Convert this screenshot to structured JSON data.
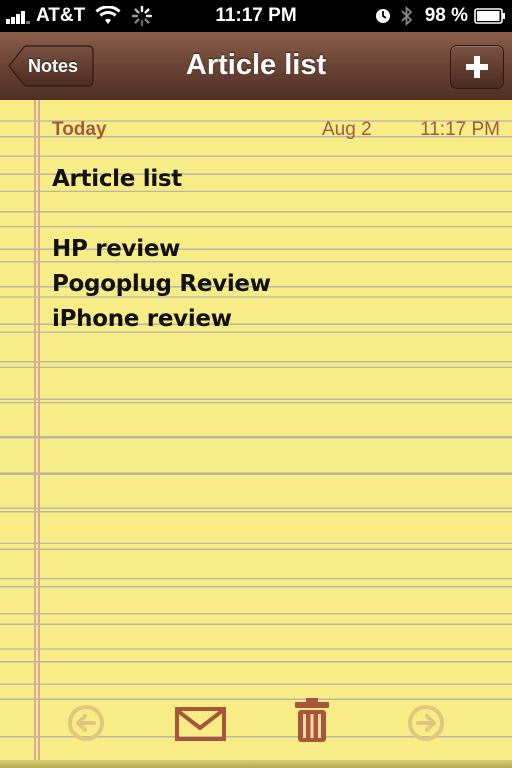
{
  "status_bar": {
    "carrier": "AT&T",
    "time": "11:17 PM",
    "battery_percent": "98 %",
    "battery_level": 0.98
  },
  "nav": {
    "back_label": "Notes",
    "title": "Article list",
    "add_icon": "plus-icon"
  },
  "note": {
    "day": "Today",
    "date": "Aug 2",
    "time": "11:17 PM",
    "lines": [
      "Article list",
      "",
      "HP review",
      "Pogoplug Review",
      "iPhone review"
    ]
  },
  "toolbar": {
    "icons": [
      "previous-arrow-icon",
      "mail-icon",
      "trash-icon",
      "next-arrow-icon"
    ],
    "previous_enabled": false,
    "next_enabled": false
  },
  "colors": {
    "paper": "#f7ec85",
    "ink": "#111111",
    "header_text": "#a25a43",
    "nav_leather": "#6d4636",
    "toolbar_icon": "#a8563a",
    "disabled_icon": "#e0c77d"
  }
}
